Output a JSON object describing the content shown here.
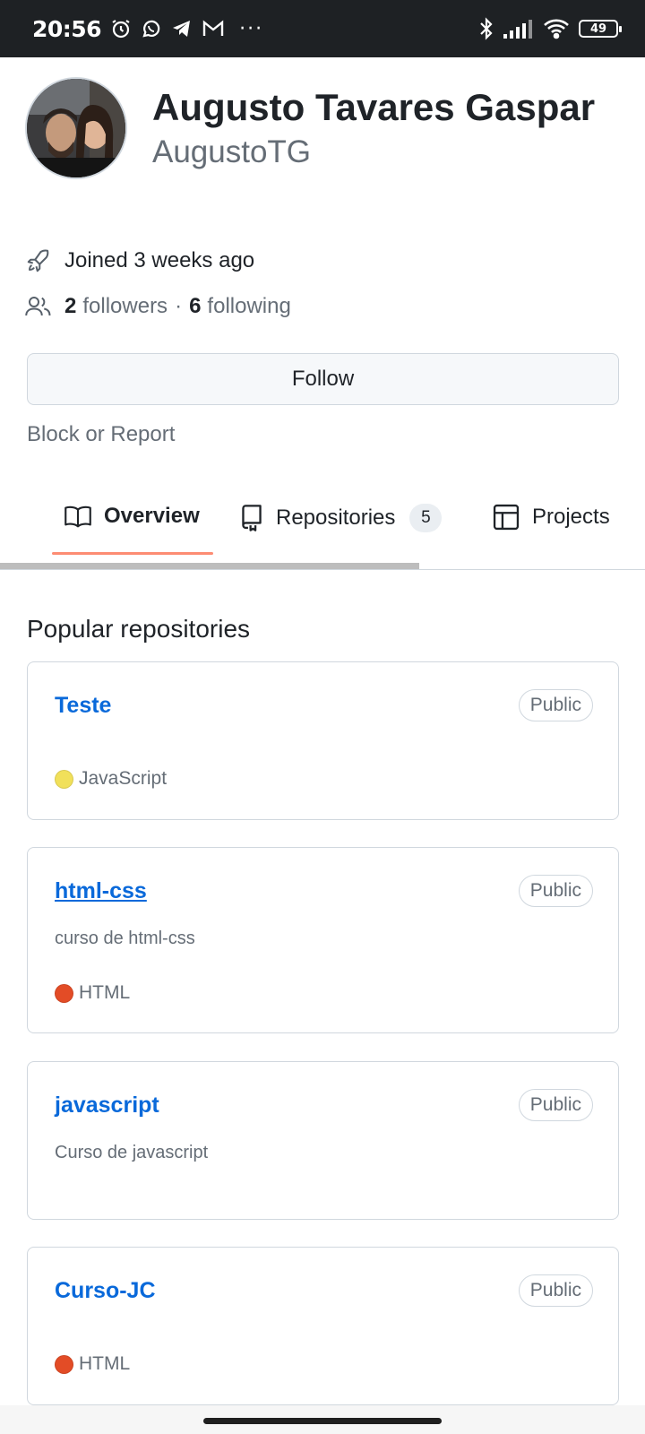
{
  "status_bar": {
    "time": "20:56",
    "battery": "49"
  },
  "profile": {
    "name": "Augusto Tavares Gaspar",
    "login": "AugustoTG",
    "joined": "Joined 3 weeks ago",
    "followers_count": "2",
    "followers_label": "followers",
    "separator": "·",
    "following_count": "6",
    "following_label": "following",
    "follow_button": "Follow",
    "block_report": "Block or Report"
  },
  "tabs": [
    {
      "label": "Overview",
      "selected": true
    },
    {
      "label": "Repositories",
      "counter": "5"
    },
    {
      "label": "Projects"
    }
  ],
  "popular": {
    "title": "Popular repositories",
    "repos": [
      {
        "name": "Teste",
        "visibility": "Public",
        "description": "",
        "language": "JavaScript",
        "language_color": "#f1e05a"
      },
      {
        "name": "html-css",
        "visibility": "Public",
        "description": "curso de html-css",
        "language": "HTML",
        "language_color": "#e34c26"
      },
      {
        "name": "javascript",
        "visibility": "Public",
        "description": "Curso de javascript",
        "language": "",
        "language_color": ""
      },
      {
        "name": "Curso-JC",
        "visibility": "Public",
        "description": "",
        "language": "HTML",
        "language_color": "#e34c26"
      }
    ]
  },
  "colors": {
    "link": "#0969da",
    "tab_underline": "#fd8c73",
    "status_bar_bg": "#1e2124"
  }
}
